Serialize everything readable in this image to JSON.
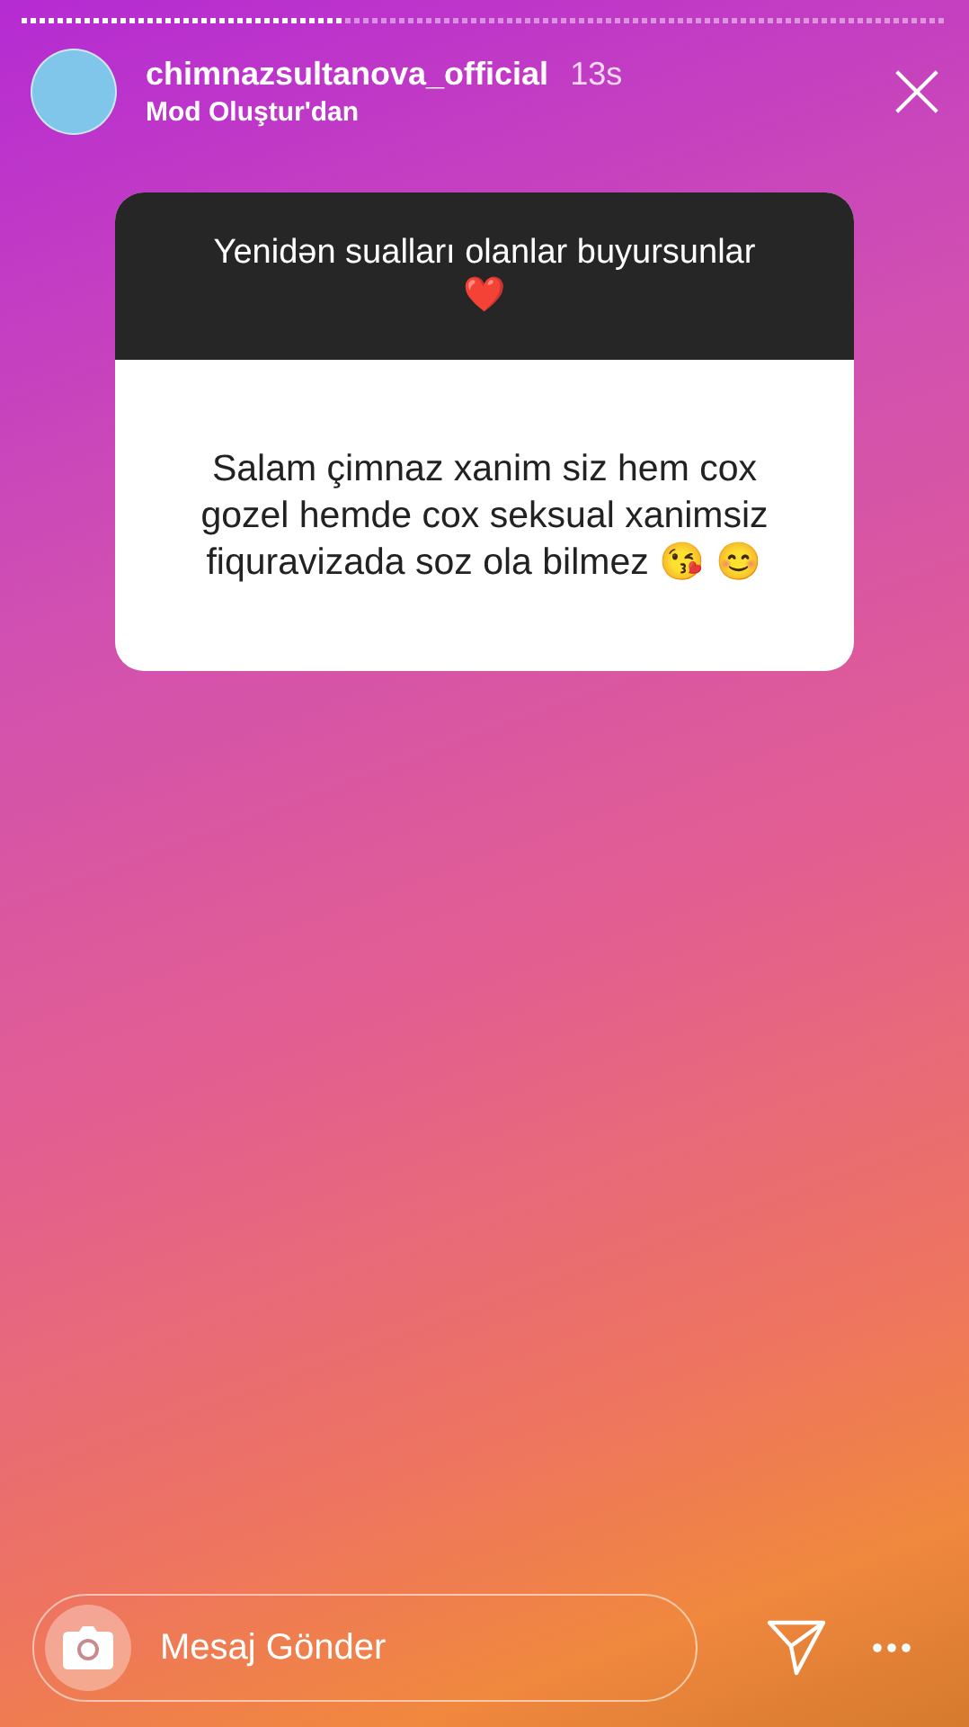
{
  "story_progress": {
    "level": 0.35
  },
  "header": {
    "username": "chimnazsultanova_official",
    "time": "13s",
    "subtitle": "Mod Oluştur'dan"
  },
  "question_card": {
    "question": "Yenidən sualları olanlar buyursunlar ❤️",
    "answer": "Salam çimnaz xanim siz hem cox gozel hemde cox seksual xanimsiz fiquravizada soz ola bilmez 😘 😊"
  },
  "message_field": {
    "placeholder": "Mesaj Gönder"
  }
}
